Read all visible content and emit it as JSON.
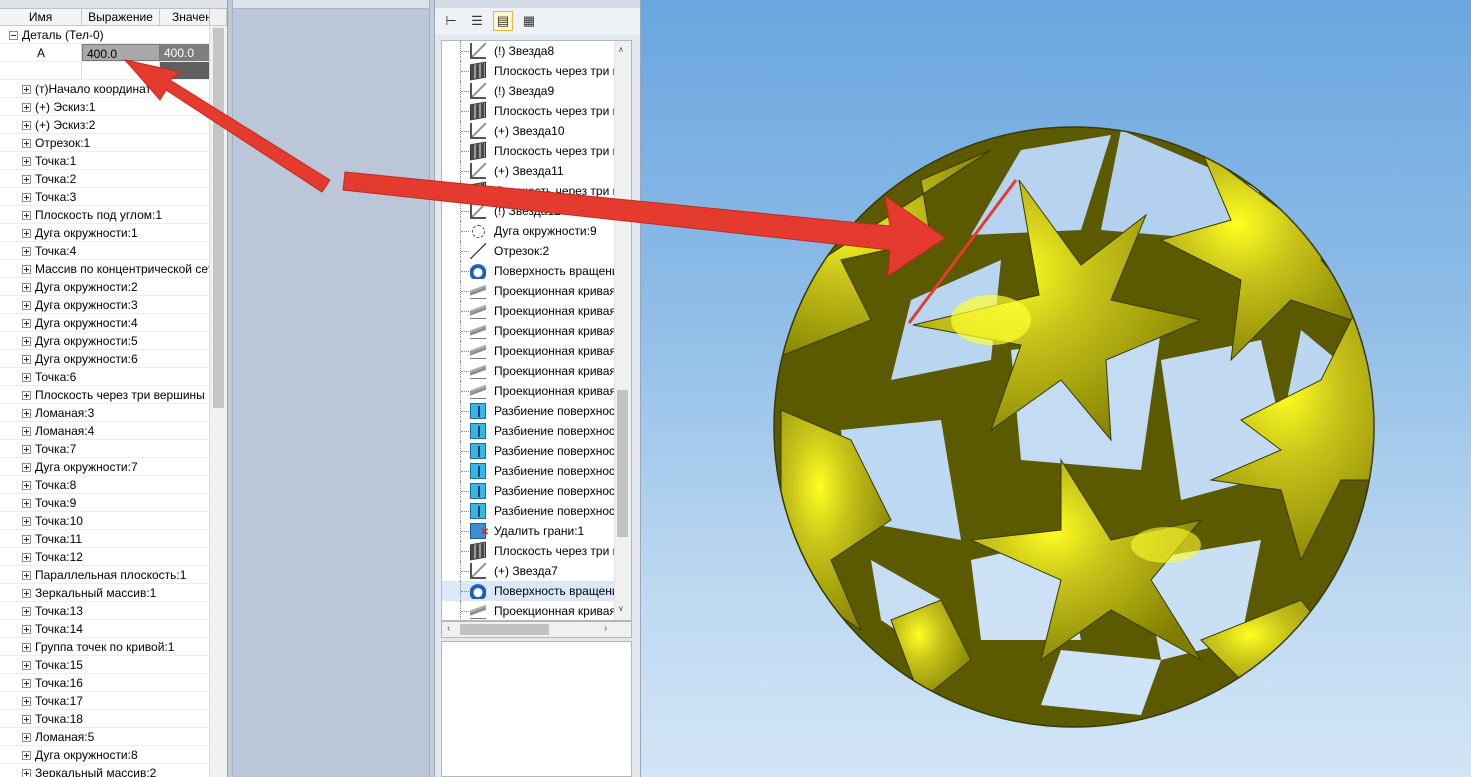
{
  "variables_panel": {
    "headers": {
      "name": "Имя",
      "expression": "Выражение",
      "value": "Значен"
    },
    "root": "Деталь (Тел-0)",
    "variable": {
      "name": "A",
      "expression": "400.0",
      "value": "400.0"
    },
    "items": [
      "(т)Начало координат",
      "(+) Эскиз:1",
      "(+) Эскиз:2",
      "Отрезок:1",
      "Точка:1",
      "Точка:2",
      "Точка:3",
      "Плоскость под углом:1",
      "Дуга окружности:1",
      "Точка:4",
      "Массив по концентрической сетке",
      "Дуга окружности:2",
      "Дуга окружности:3",
      "Дуга окружности:4",
      "Дуга окружности:5",
      "Дуга окружности:6",
      "Точка:6",
      "Плоскость через три вершины",
      "Ломаная:3",
      "Ломаная:4",
      "Точка:7",
      "Дуга окружности:7",
      "Точка:8",
      "Точка:9",
      "Точка:10",
      "Точка:11",
      "Точка:12",
      "Параллельная плоскость:1",
      "Зеркальный массив:1",
      "Точка:13",
      "Точка:14",
      "Группа точек по кривой:1",
      "Точка:15",
      "Точка:16",
      "Точка:17",
      "Точка:18",
      "Ломаная:5",
      "Дуга окружности:8",
      "Зеркальный массив:2"
    ]
  },
  "build_tree": {
    "toolbar": [
      "tree-view-icon",
      "list-view-icon",
      "properties-icon",
      "details-icon"
    ],
    "items": [
      {
        "icon": "sketch",
        "label": "(!) Звезда8"
      },
      {
        "icon": "plane",
        "label": "Плоскость через три вершины"
      },
      {
        "icon": "sketch",
        "label": "(!) Звезда9"
      },
      {
        "icon": "plane",
        "label": "Плоскость через три вершины"
      },
      {
        "icon": "sketch",
        "label": "(+) Звезда10"
      },
      {
        "icon": "plane",
        "label": "Плоскость через три вершины"
      },
      {
        "icon": "sketch",
        "label": "(+) Звезда11"
      },
      {
        "icon": "plane",
        "label": "Плоскость через три вершины"
      },
      {
        "icon": "sketch",
        "label": "(!) Звезда12"
      },
      {
        "icon": "arc",
        "label": "Дуга окружности:9"
      },
      {
        "icon": "segment",
        "label": "Отрезок:2"
      },
      {
        "icon": "revolve",
        "label": "Поверхность вращения"
      },
      {
        "icon": "projection",
        "label": "Проекционная кривая"
      },
      {
        "icon": "projection",
        "label": "Проекционная кривая"
      },
      {
        "icon": "projection",
        "label": "Проекционная кривая"
      },
      {
        "icon": "projection",
        "label": "Проекционная кривая"
      },
      {
        "icon": "projection",
        "label": "Проекционная кривая"
      },
      {
        "icon": "projection",
        "label": "Проекционная кривая"
      },
      {
        "icon": "split",
        "label": "Разбиение поверхности"
      },
      {
        "icon": "split",
        "label": "Разбиение поверхности"
      },
      {
        "icon": "split",
        "label": "Разбиение поверхности"
      },
      {
        "icon": "split",
        "label": "Разбиение поверхности"
      },
      {
        "icon": "split",
        "label": "Разбиение поверхности"
      },
      {
        "icon": "split",
        "label": "Разбиение поверхности"
      },
      {
        "icon": "delete-faces",
        "label": "Удалить грани:1"
      },
      {
        "icon": "plane",
        "label": "Плоскость через три вершины"
      },
      {
        "icon": "sketch",
        "label": "(+) Звезда7"
      },
      {
        "icon": "revolve",
        "label": "Поверхность вращения"
      },
      {
        "icon": "projection",
        "label": "Проекционная кривая"
      }
    ],
    "selected_index": 27
  },
  "colors": {
    "annotation_arrow": "#e53b2f",
    "model_face": "#b2b21a",
    "model_shadow": "#5c5a00",
    "viewport_sky": "#7fb3e3"
  }
}
